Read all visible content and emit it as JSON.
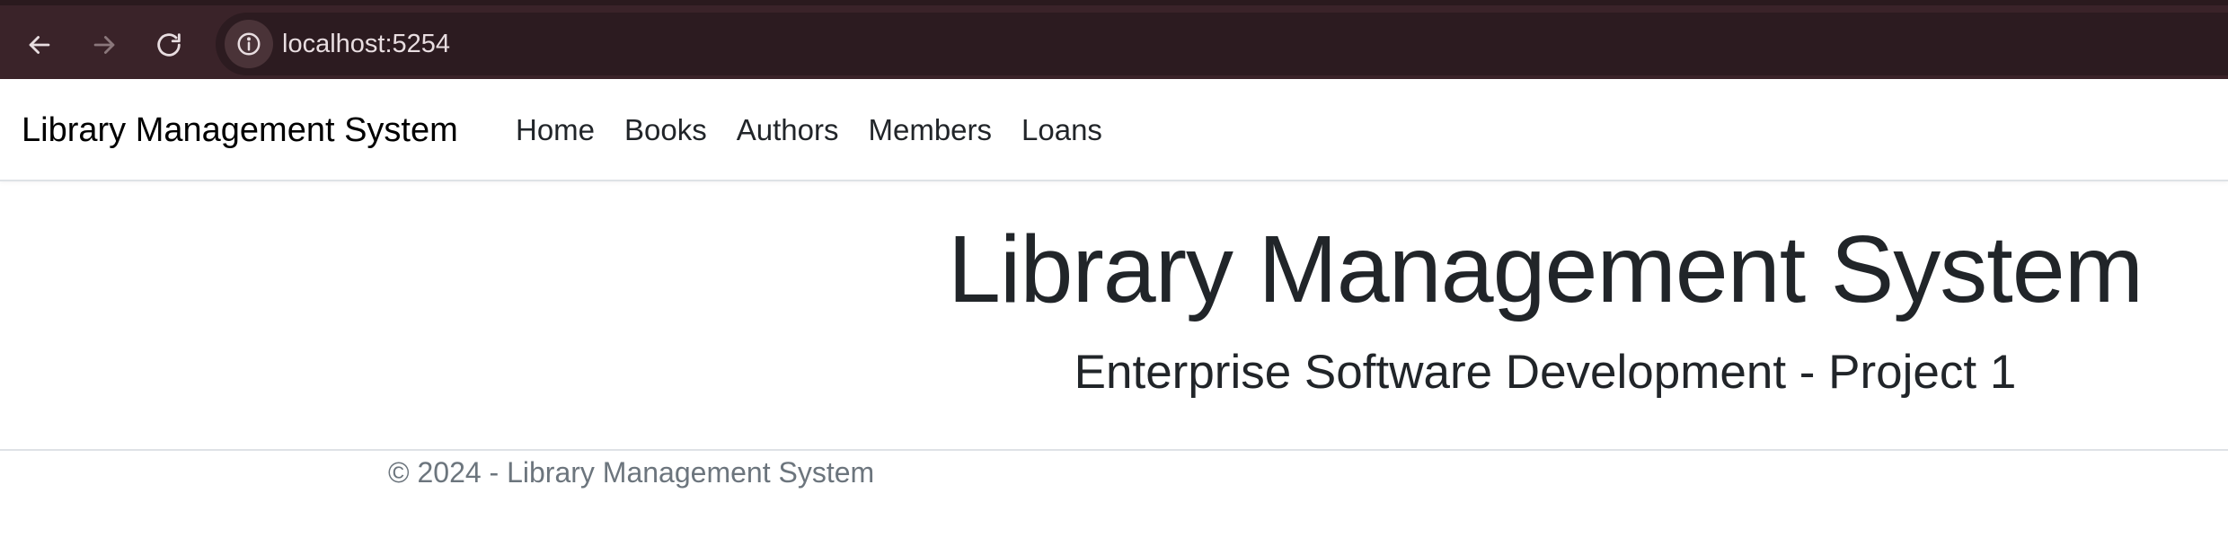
{
  "browser": {
    "url": "localhost:5254",
    "icons": {
      "back": "arrow-left-icon",
      "forward": "arrow-right-icon",
      "reload": "reload-icon",
      "site_info": "info-icon"
    },
    "colors": {
      "chrome_bg": "#3a2329",
      "address_bg": "#2c1b20"
    }
  },
  "navbar": {
    "brand": "Library Management System",
    "links": [
      {
        "label": "Home"
      },
      {
        "label": "Books"
      },
      {
        "label": "Authors"
      },
      {
        "label": "Members"
      },
      {
        "label": "Loans"
      }
    ]
  },
  "main": {
    "title": "Library Management System",
    "subtitle": "Enterprise Software Development - Project 1"
  },
  "footer": {
    "text": "© 2024 - Library Management System"
  }
}
